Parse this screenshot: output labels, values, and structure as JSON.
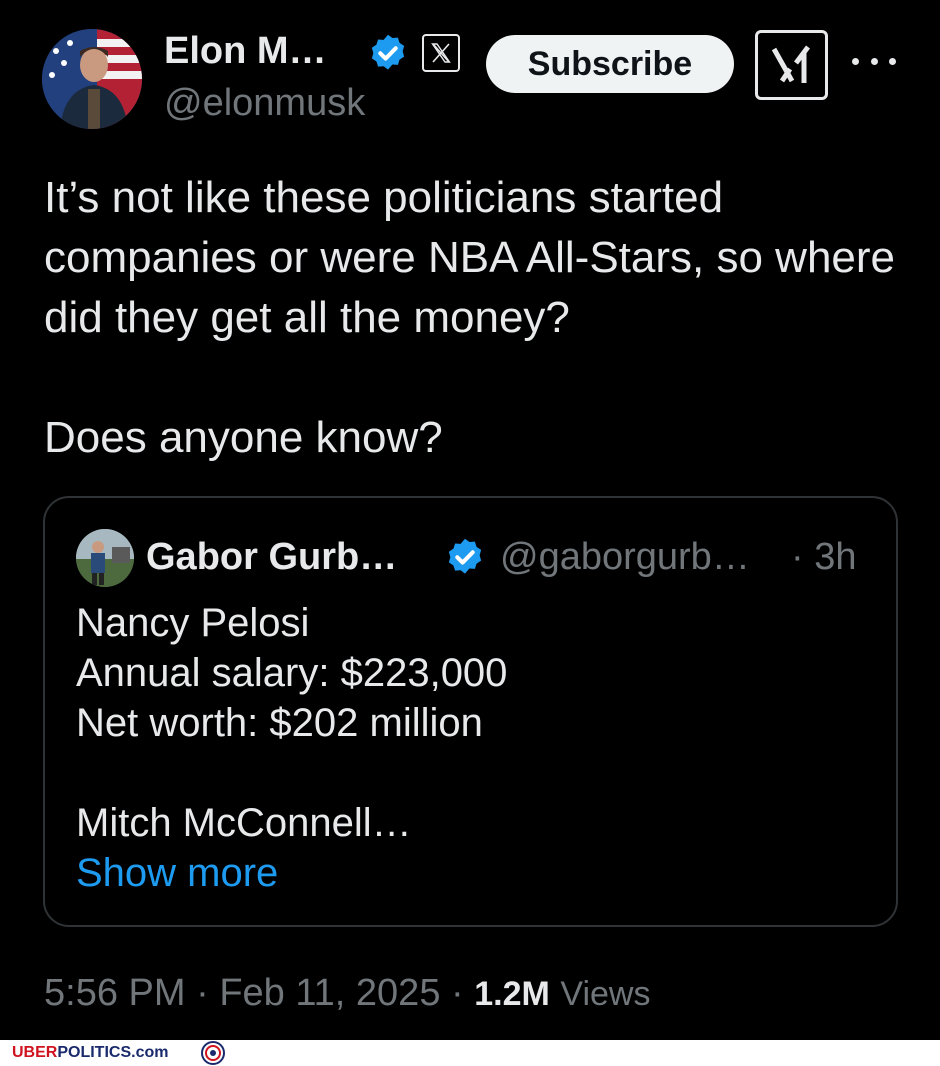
{
  "author": {
    "name": "Elon M…",
    "handle": "@elonmusk"
  },
  "header": {
    "subscribe_label": "Subscribe",
    "icons": [
      "verified-badge-icon",
      "x-logo-icon",
      "grok-icon",
      "more-icon"
    ]
  },
  "tweet": {
    "paragraph1": "It’s not like these politicians started companies or were NBA All-Stars, so where did they get all the money?",
    "paragraph2": "Does anyone know?"
  },
  "quote": {
    "name": "Gabor Gurb…",
    "handle": "@gaborgurb…",
    "time": "· 3h",
    "lines": {
      "l1": "Nancy Pelosi",
      "l2": "Annual salary: $223,000",
      "l3": "Net worth: $202 million",
      "l4": "Mitch McConnell…"
    },
    "show_more": "Show more"
  },
  "meta": {
    "time": "5:56 PM",
    "date": "Feb 11, 2025",
    "views_count": "1.2M",
    "views_label": "Views"
  },
  "watermark": {
    "part1": "UBER",
    "part2": "POLITICS.com"
  },
  "colors": {
    "background": "#000000",
    "text": "#e7e9ea",
    "muted": "#71767b",
    "link": "#1d9bf0",
    "border": "#2f3336"
  }
}
